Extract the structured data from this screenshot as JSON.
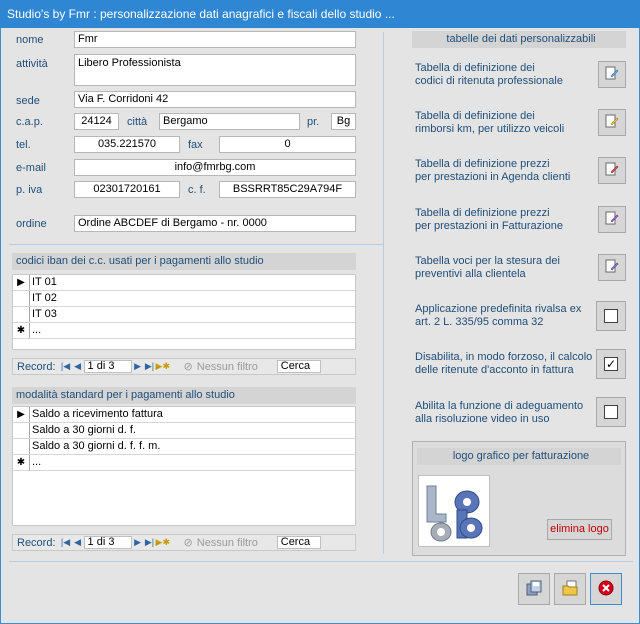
{
  "window": {
    "title": "Studio's by Fmr : personalizzazione dati anagrafici e fiscali dello studio ..."
  },
  "anagrafica": {
    "nome_label": "nome",
    "nome": "Fmr",
    "attivita_label": "attività",
    "attivita": "Libero Professionista",
    "sede_label": "sede",
    "sede": "Via F. Corridoni 42",
    "cap_label": "c.a.p.",
    "cap": "24124",
    "citta_label": "città",
    "citta": "Bergamo",
    "pr_label": "pr.",
    "pr": "Bg",
    "tel_label": "tel.",
    "tel": "035.221570",
    "fax_label": "fax",
    "fax": "0",
    "email_label": "e-mail",
    "email": "info@fmrbg.com",
    "piva_label": "p. iva",
    "piva": "02301720161",
    "cf_label": "c. f.",
    "cf": "BSSRRT85C29A794F",
    "ordine_label": "ordine",
    "ordine": "Ordine ABCDEF di Bergamo - nr. 0000"
  },
  "iban": {
    "header": "codici iban dei c.c. usati per i pagamenti allo studio",
    "rows": [
      "IT 01",
      "IT 02",
      "IT 03"
    ],
    "new_row": "...",
    "nav": {
      "record_label": "Record:",
      "position": "1 di 3",
      "filter": "Nessun filtro",
      "search": "Cerca"
    }
  },
  "pagamenti": {
    "header": "modalità standard per i pagamenti allo studio",
    "rows": [
      "Saldo a ricevimento fattura",
      "Saldo a 30 giorni d. f.",
      "Saldo a 30 giorni d. f. f. m."
    ],
    "new_row": "...",
    "nav": {
      "record_label": "Record:",
      "position": "1 di 3",
      "filter": "Nessun filtro",
      "search": "Cerca"
    }
  },
  "tabelle": {
    "title": "tabelle dei dati personalizzabili",
    "items": [
      {
        "line1": "Tabella di definizione dei",
        "line2": "codici di ritenuta professionale",
        "icon": "edit-icon"
      },
      {
        "line1": "Tabella di definizione dei",
        "line2": "rimborsi km, per utilizzo veicoli",
        "icon": "edit-icon"
      },
      {
        "line1": "Tabella di definizione prezzi",
        "line2": "per prestazioni in Agenda clienti",
        "icon": "edit-icon"
      },
      {
        "line1": "Tabella di definizione prezzi",
        "line2": "per prestazioni in Fatturazione",
        "icon": "edit-icon"
      },
      {
        "line1": "Tabella voci per la stesura dei",
        "line2": "preventivi alla clientela",
        "icon": "edit-icon"
      }
    ]
  },
  "opzioni": [
    {
      "line1": "Applicazione predefinita rivalsa ex",
      "line2": "art. 2 L. 335/95 comma 32",
      "checked": ""
    },
    {
      "line1": "Disabilita, in modo forzoso, il calcolo",
      "line2": "delle ritenute d'acconto in fattura",
      "checked": "✓"
    },
    {
      "line1": "Abilita la funzione di adeguamento",
      "line2": "alla risoluzione video in uso",
      "checked": ""
    }
  ],
  "logo": {
    "title": "logo grafico per fatturazione",
    "remove_label": "elimina logo"
  },
  "colors": {
    "label": "#1f4e79",
    "remove": "#c00000",
    "close": "#d9001b"
  }
}
